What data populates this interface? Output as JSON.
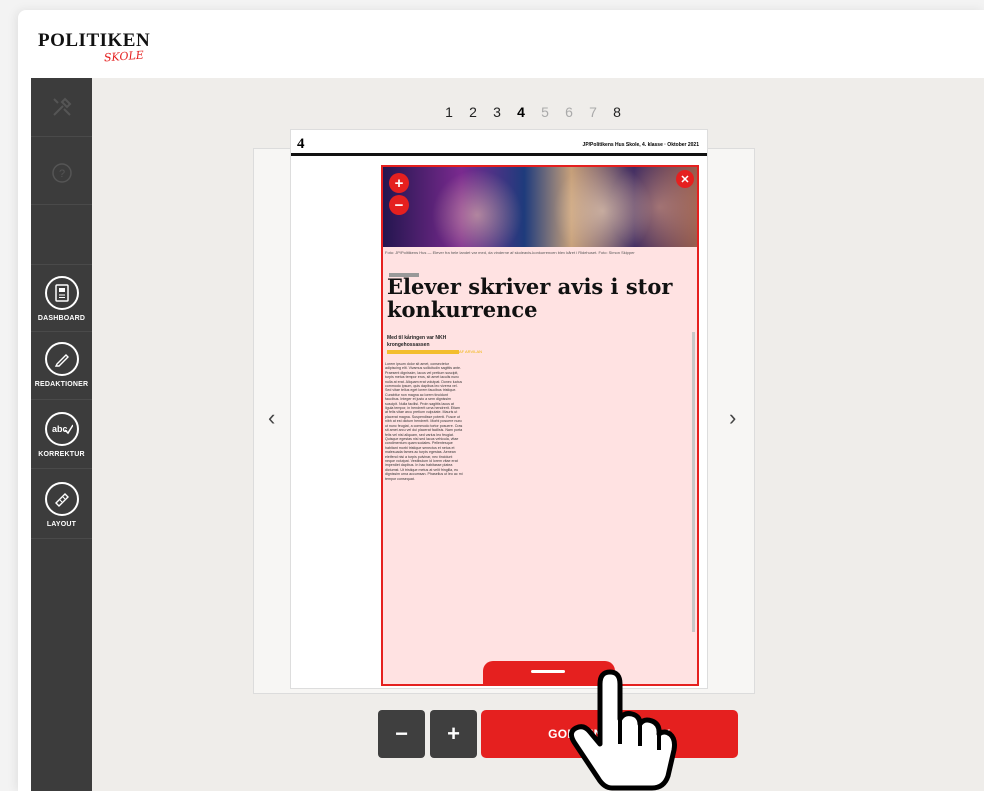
{
  "brand": {
    "name": "POLITIKEN",
    "sub": "SKOLE"
  },
  "sidebar": {
    "items": [
      {
        "label": "DASHBOARD",
        "icon": "dashboard-icon"
      },
      {
        "label": "REDAKTIONER",
        "icon": "pencil-icon"
      },
      {
        "label": "KORREKTUR",
        "icon": "spellcheck-icon"
      },
      {
        "label": "LAYOUT",
        "icon": "ruler-icon"
      }
    ]
  },
  "pager": {
    "pages": [
      "1",
      "2",
      "3",
      "4",
      "5",
      "6",
      "7",
      "8"
    ],
    "active": "4"
  },
  "paper": {
    "page_number": "4",
    "publication": "JP/Politikens Hus Skole, 4. klasse · Oktober 2021"
  },
  "article": {
    "headline": "Elever skriver avis i stor konkurrence",
    "deck": "Med til kåringen var NKH krongehossassen",
    "byline": "AF ARVILAN",
    "caption": "Foto: JP/Politikens Hus — Elever fra hele landet var med, da vinderne af skoleavis-konkurrencen blev kåret i Ridehuset. Foto: Simon Skipper"
  },
  "controls": {
    "minus": "−",
    "plus": "+",
    "approve": "GODKEND TIL TRYK"
  },
  "colors": {
    "accent": "#e5201f",
    "sidebar": "#3c3c3c"
  }
}
